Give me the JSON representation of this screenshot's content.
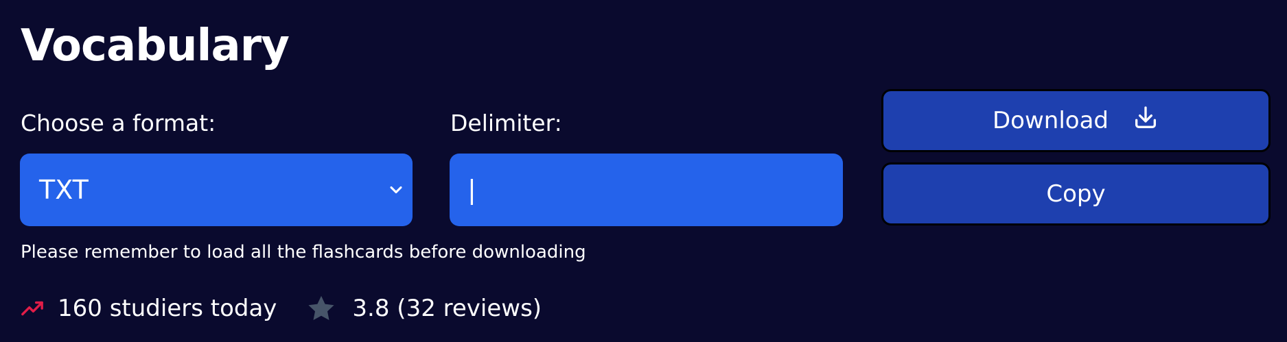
{
  "title": "Vocabulary",
  "format": {
    "label": "Choose a format:",
    "selected": "TXT"
  },
  "delimiter": {
    "label": "Delimiter:",
    "value": "|"
  },
  "buttons": {
    "download": "Download",
    "copy": "Copy"
  },
  "note": "Please remember to load all the flashcards before downloading",
  "stats": {
    "studiers": "160 studiers today",
    "rating": "3.8 (32 reviews)"
  },
  "icons": {
    "trend": "trending-up-icon",
    "star": "star-icon",
    "download": "download-icon",
    "chevron": "chevron-down-icon"
  },
  "colors": {
    "background": "#0a0a2e",
    "field": "#2563eb",
    "button": "#1e40af",
    "trend": "#e11d48",
    "star": "#475569"
  }
}
